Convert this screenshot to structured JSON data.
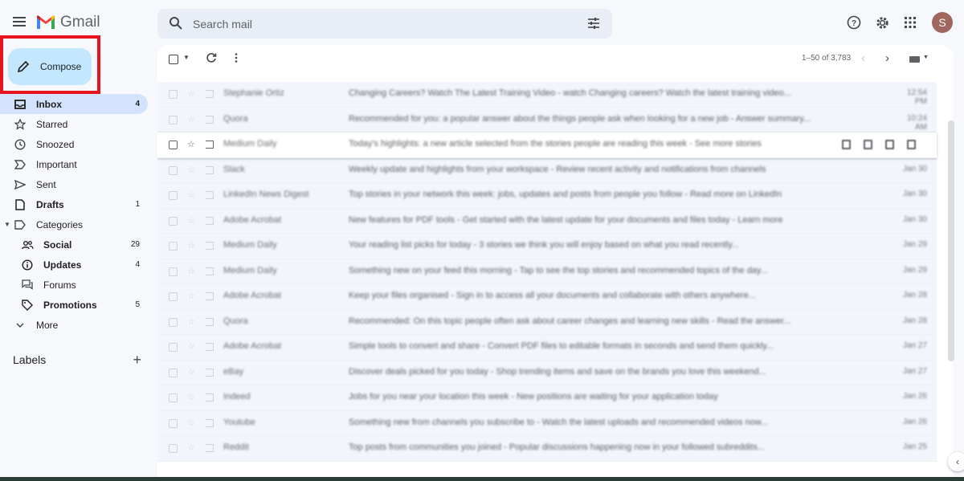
{
  "app": {
    "name": "Gmail"
  },
  "search": {
    "placeholder": "Search mail"
  },
  "user": {
    "initial": "S"
  },
  "compose": {
    "label": "Compose"
  },
  "sidebar": {
    "items": [
      {
        "label": "Inbox",
        "count": "4"
      },
      {
        "label": "Starred",
        "count": ""
      },
      {
        "label": "Snoozed",
        "count": ""
      },
      {
        "label": "Important",
        "count": ""
      },
      {
        "label": "Sent",
        "count": ""
      },
      {
        "label": "Drafts",
        "count": "1"
      },
      {
        "label": "Categories",
        "count": ""
      },
      {
        "label": "Social",
        "count": "29"
      },
      {
        "label": "Updates",
        "count": "4"
      },
      {
        "label": "Forums",
        "count": ""
      },
      {
        "label": "Promotions",
        "count": "5"
      },
      {
        "label": "More",
        "count": ""
      }
    ],
    "labels_heading": "Labels",
    "add_label": "+"
  },
  "toolbar": {
    "pager": "1–50 of 3,783"
  },
  "emails": [
    {
      "sender": "Stephanie Ortiz",
      "snippet": "Changing Careers? Watch The Latest Training Video - watch Changing careers? Watch the latest training video...",
      "date": "12:54 PM"
    },
    {
      "sender": "Quora",
      "snippet": "Recommended for you: a popular answer about the things people ask when looking for a new job - Answer summary...",
      "date": "10:24 AM"
    },
    {
      "sender": "Medium Daily",
      "snippet": "Today's highlights: a new article selected from the stories people are reading this week - See more stories",
      "date": ""
    },
    {
      "sender": "Slack",
      "snippet": "Weekly update and highlights from your workspace - Review recent activity and notifications from channels",
      "date": "Jan 30"
    },
    {
      "sender": "LinkedIn News Digest",
      "snippet": "Top stories in your network this week: jobs, updates and posts from people you follow - Read more on LinkedIn",
      "date": "Jan 30"
    },
    {
      "sender": "Adobe Acrobat",
      "snippet": "New features for PDF tools - Get started with the latest update for your documents and files today - Learn more",
      "date": "Jan 30"
    },
    {
      "sender": "Medium Daily",
      "snippet": "Your reading list picks for today - 3 stories we think you will enjoy based on what you read recently...",
      "date": "Jan 29"
    },
    {
      "sender": "Medium Daily",
      "snippet": "Something new on your feed this morning - Tap to see the top stories and recommended topics of the day...",
      "date": "Jan 29"
    },
    {
      "sender": "Adobe Acrobat",
      "snippet": "Keep your files organised - Sign in to access all your documents and collaborate with others anywhere...",
      "date": "Jan 28"
    },
    {
      "sender": "Quora",
      "snippet": "Recommended: On this topic people often ask about career changes and learning new skills - Read the answer...",
      "date": "Jan 28"
    },
    {
      "sender": "Adobe Acrobat",
      "snippet": "Simple tools to convert and share - Convert PDF files to editable formats in seconds and send them quickly...",
      "date": "Jan 27"
    },
    {
      "sender": "eBay",
      "snippet": "Discover deals picked for you today - Shop trending items and save on the brands you love this weekend...",
      "date": "Jan 27"
    },
    {
      "sender": "Indeed",
      "snippet": "Jobs for you near your location this week - New positions are waiting for your application today",
      "date": "Jan 26"
    },
    {
      "sender": "Youtube",
      "snippet": "Something new from channels you subscribe to - Watch the latest uploads and recommended videos now...",
      "date": "Jan 26"
    },
    {
      "sender": "Reddit",
      "snippet": "Top posts from communities you joined - Popular discussions happening now in your followed subreddits...",
      "date": "Jan 25"
    }
  ]
}
